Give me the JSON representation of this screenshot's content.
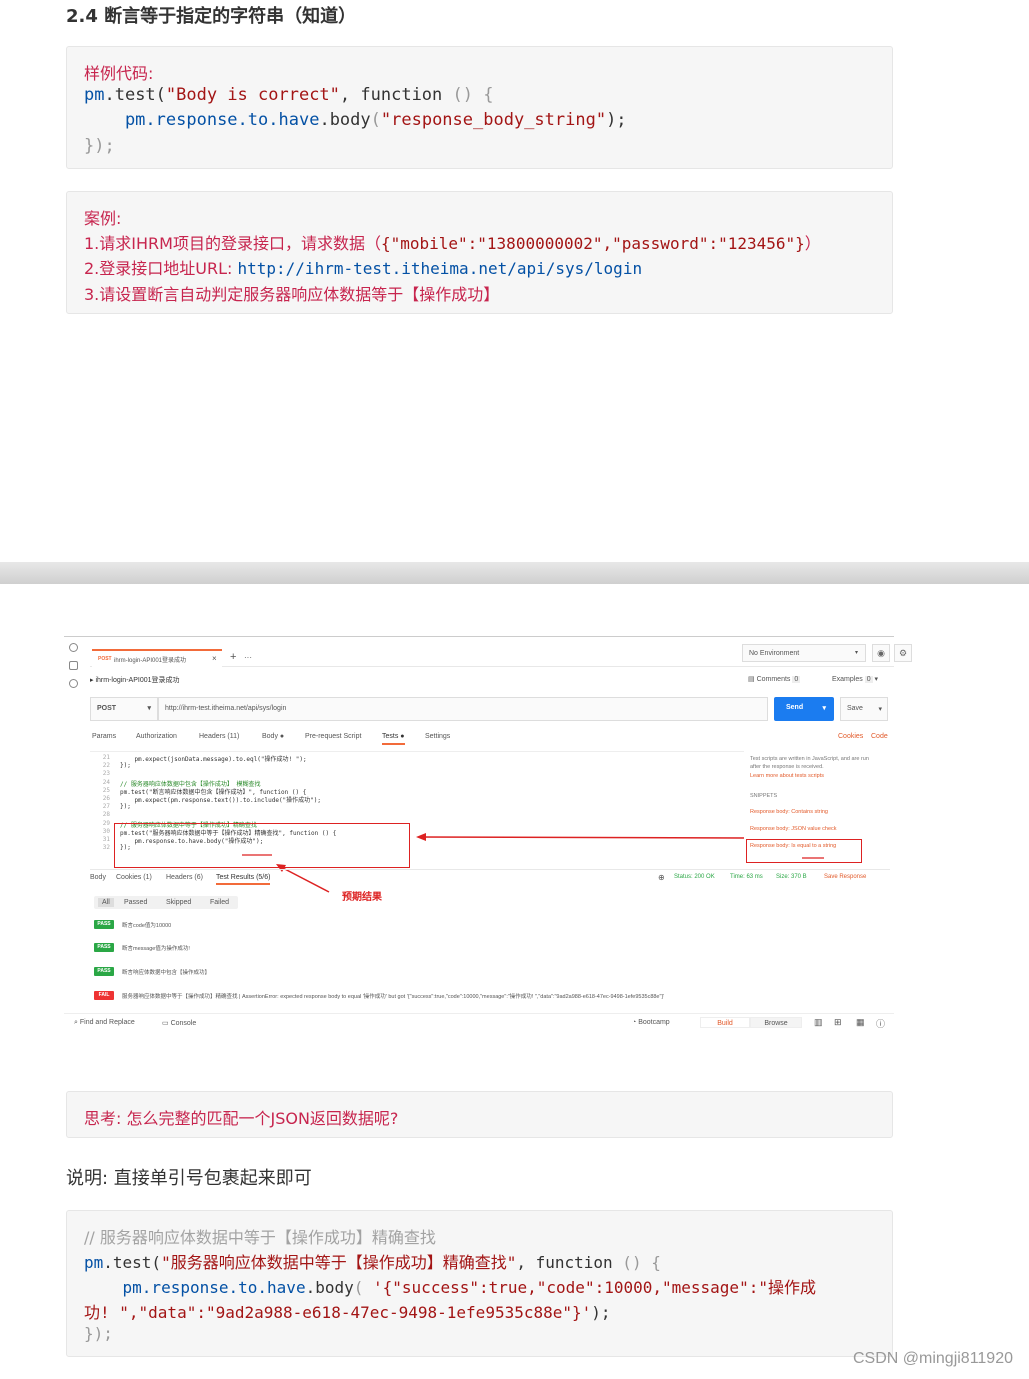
{
  "heading": "2.4 断言等于指定的字符串（知道）",
  "sample": {
    "label": "样例代码:",
    "line1": [
      "pm",
      ".test(",
      "\"Body is correct\"",
      ", ",
      "function",
      " () {"
    ],
    "line2": [
      "    pm",
      ".response",
      ".to",
      ".have",
      ".body",
      "(",
      "\"response_body_string\"",
      ");"
    ],
    "line3": "});"
  },
  "example": {
    "label": "案例:",
    "line1_prefix": "1.请求IHRM项目的登录接口，请求数据（",
    "line1_data": "{\"mobile\":\"13800000002\",\"password\":\"123456\"}",
    "line1_suffix": "）",
    "line2_prefix": "2.登录接口地址URL: ",
    "line2_url": "http://ihrm-test.itheima.net/api/sys/login",
    "line3": "3.请设置断言自动判定服务器响应体数据等于【操作成功】"
  },
  "postman": {
    "tab_method": "POST",
    "tab_title": "ihrm-login-API001登录成功",
    "tab_close": "×",
    "tab_plus": "+",
    "tab_more": "···",
    "environment": "No Environment",
    "breadcrumb": "ihrm-login-API001登录成功",
    "comments": "Comments",
    "comments_count": "0",
    "examples": "Examples",
    "examples_count": "0",
    "method": "POST",
    "url": "http://ihrm-test.itheima.net/api/sys/login",
    "send": "Send",
    "save": "Save",
    "subtabs": [
      "Params",
      "Authorization",
      "Headers (11)",
      "Body ●",
      "Pre-request Script",
      "Tests ●",
      "Settings"
    ],
    "cookies": "Cookies",
    "code": "Code",
    "editor_lines": [
      {
        "n": "21",
        "t": "    pm.expect(jsonData.message).to.eql(\"操作成功! \");"
      },
      {
        "n": "22",
        "t": "});"
      },
      {
        "n": "23",
        "t": ""
      },
      {
        "n": "24",
        "t": "// 服务器响应体数据中包含【操作成功】 模糊查找"
      },
      {
        "n": "25",
        "t": "pm.test(\"断言响应体数据中包含【操作成功】\", function () {"
      },
      {
        "n": "26",
        "t": "    pm.expect(pm.response.text()).to.include(\"操作成功\");"
      },
      {
        "n": "27",
        "t": "});"
      },
      {
        "n": "28",
        "t": ""
      },
      {
        "n": "29",
        "t": "// 服务器响应体数据中等于【操作成功】精确查找"
      },
      {
        "n": "30",
        "t": "pm.test(\"服务器响应体数据中等于【操作成功】精确查找\", function () {"
      },
      {
        "n": "31",
        "t": "    pm.response.to.have.body(\"操作成功\");"
      },
      {
        "n": "32",
        "t": "});"
      }
    ],
    "snippet_intro": "Test scripts are written in JavaScript, and are run after the response is received.",
    "snippet_learn": "Learn more about tests scripts",
    "snippets_title": "SNIPPETS",
    "snippets": [
      "Response body: Contains string",
      "Response body: JSON value check",
      "Response body: Is equal to a string"
    ],
    "resp_tabs": [
      "Body",
      "Cookies (1)",
      "Headers (6)",
      "Test Results (5/6)"
    ],
    "status": "Status: 200 OK",
    "time": "Time: 63 ms",
    "size": "Size: 370 B",
    "save_response": "Save Response",
    "filters": [
      "All",
      "Passed",
      "Skipped",
      "Failed"
    ],
    "annotation": "预期结果",
    "results": [
      {
        "status": "PASS",
        "text": "断言code值为10000"
      },
      {
        "status": "PASS",
        "text": "断言message值为操作成功!"
      },
      {
        "status": "PASS",
        "text": "断言响应体数据中包含【操作成功】"
      },
      {
        "status": "FAIL",
        "text": "服务器响应体数据中等于【操作成功】精确查找 | AssertionError: expected response body to equal '操作成功' but got '{\"success\":true,\"code\":10000,\"message\":\"操作成功! \",\"data\":\"9ad2a988-e618-47ec-9498-1efe9535c88e\"}'"
      }
    ],
    "footer_find": "Find and Replace",
    "footer_console": "Console",
    "footer_bootcamp": "Bootcamp",
    "footer_build": "Build",
    "footer_browse": "Browse"
  },
  "think": "思考: 怎么完整的匹配一个JSON返回数据呢?",
  "note": "说明: 直接单引号包裹起来即可",
  "final": {
    "comment": "// 服务器响应体数据中等于【操作成功】精确查找",
    "line1": [
      "pm",
      ".test(",
      "\"服务器响应体数据中等于【操作成功】精确查找\"",
      ", ",
      "function",
      " () {"
    ],
    "line2": [
      "    pm",
      ".response",
      ".to",
      ".have",
      ".body",
      "( ",
      "'{\"success\":true,\"code\":10000,\"message\":\"操作成"
    ],
    "line3": "功! \",\"data\":\"9ad2a988-e618-47ec-9498-1efe9535c88e\"}'",
    "line3_end": ");",
    "line4": "});"
  },
  "watermark": "CSDN @mingji811920",
  "colors": {
    "red": "#c7254e",
    "blue": "#0451a5",
    "send": "#1b7cf0",
    "pass": "#2aa745",
    "fail": "#e33",
    "annotation_red": "#d22"
  }
}
